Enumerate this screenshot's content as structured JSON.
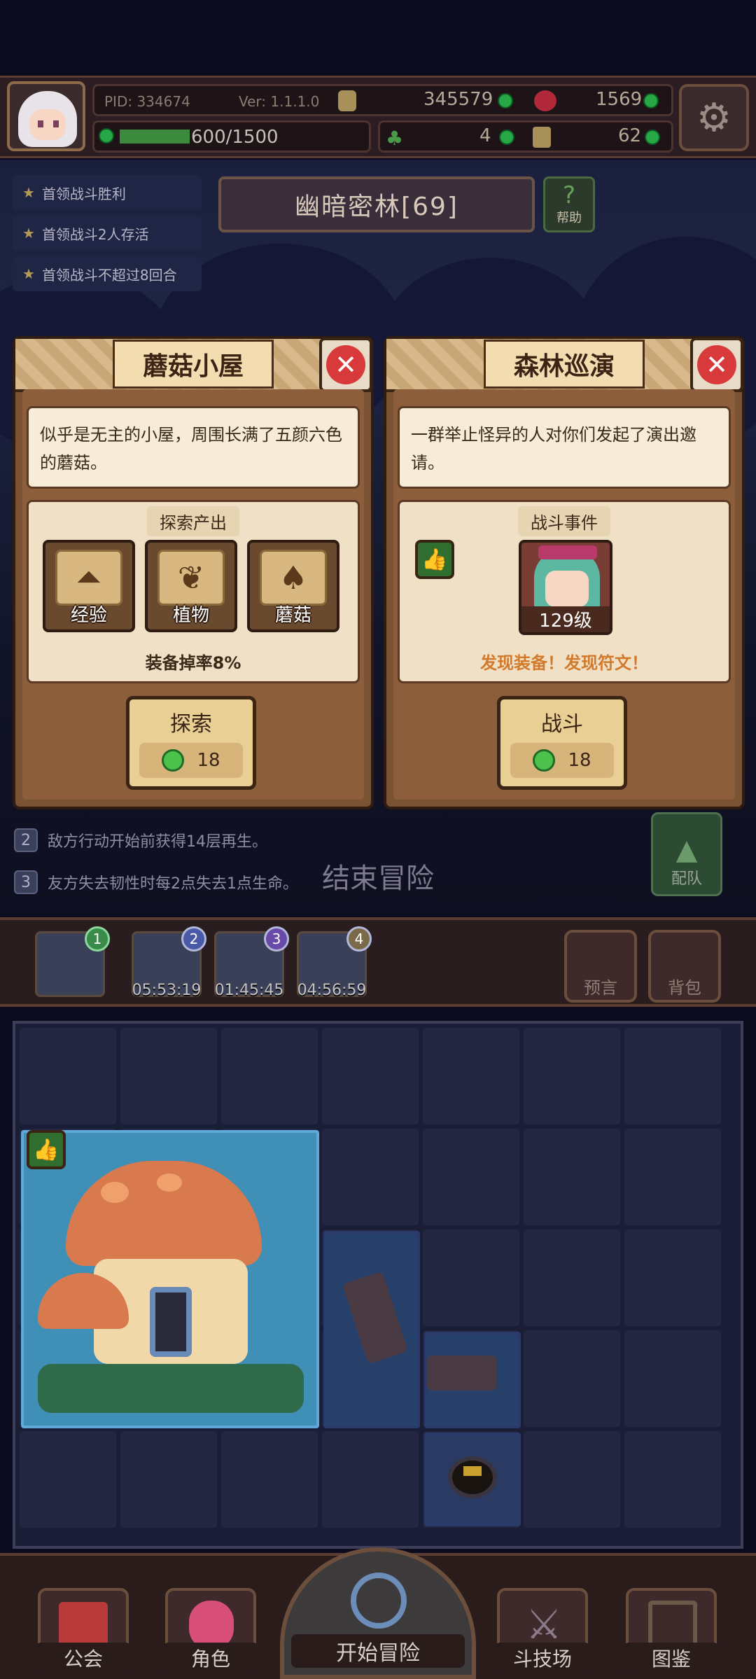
{
  "player": {
    "pid": "PID: 334674",
    "version": "Ver: 1.1.1.0",
    "energy": "600/1500"
  },
  "currencies": {
    "coins": "345579",
    "hearts": "1569",
    "clovers": "4",
    "items": "62"
  },
  "quests": [
    "首领战斗胜利",
    "首领战斗2人存活",
    "首领战斗不超过8回合"
  ],
  "zone": {
    "title": "幽暗密林[69]",
    "help": "帮助",
    "help_icon": "?"
  },
  "card1": {
    "title": "蘑菇小屋",
    "close": "✕",
    "description": "似乎是无主的小屋，周围长满了五颜六色的蘑菇。",
    "section_title": "探索产出",
    "rewards": [
      "经验",
      "植物",
      "蘑菇"
    ],
    "drop_rate": "装备掉率8%",
    "action": "探索",
    "cost": "18"
  },
  "card2": {
    "title": "森林巡演",
    "close": "✕",
    "description": "一群举止怪异的人对你们发起了演出邀请。",
    "section_title": "战斗事件",
    "enemy_level": "129级",
    "discovery": "发现装备！发现符文！",
    "action": "战斗",
    "cost": "18"
  },
  "rules": [
    {
      "n": "2",
      "text": "敌方行动开始前获得14层再生。"
    },
    {
      "n": "3",
      "text": "友方失去韧性时每2点失去1点生命。"
    }
  ],
  "end_adventure": "结束冒险",
  "team": "配队",
  "slots": [
    {
      "n": "1",
      "time": ""
    },
    {
      "n": "2",
      "time": "05:53:19"
    },
    {
      "n": "3",
      "time": "01:45:45"
    },
    {
      "n": "4",
      "time": "04:56:59"
    }
  ],
  "side": {
    "prophecy": "预言",
    "bag": "背包"
  },
  "nav": {
    "guild": "公会",
    "character": "角色",
    "start": "开始冒险",
    "arena": "斗技场",
    "codex": "图鉴"
  },
  "colors": {
    "accent_green": "#4cc24c",
    "close_red": "#d8393a",
    "card_brown": "#7a5234",
    "discovery_orange": "#d27a2c"
  }
}
